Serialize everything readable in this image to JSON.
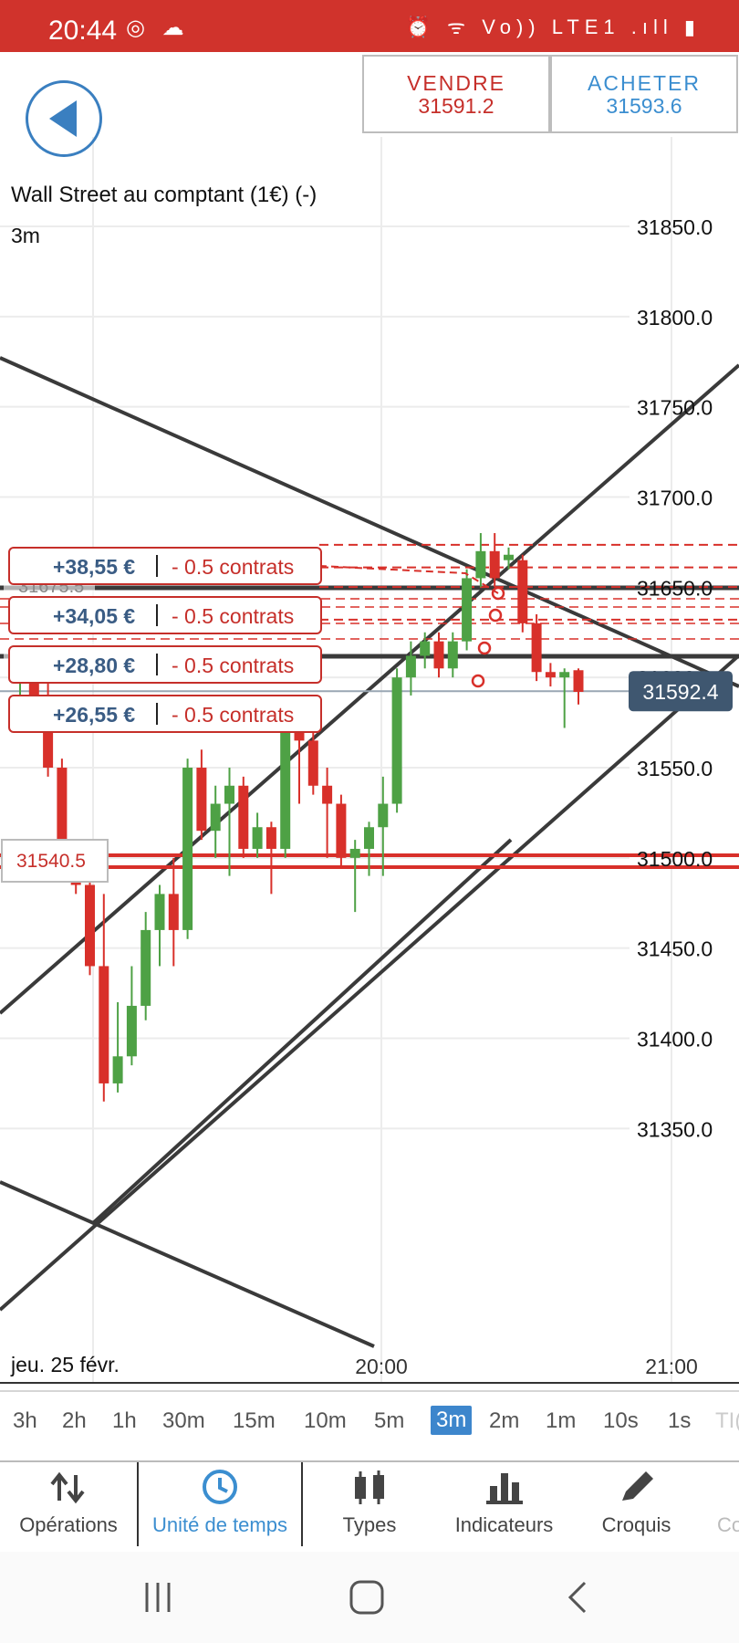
{
  "status_bar": {
    "time": "20:44",
    "icons_left": "◎ ☁",
    "icons_right": "⏰ ᯤ Vo)) LTE1 .ıll ▮"
  },
  "quote": {
    "sell_label": "VENDRE",
    "sell_price": "31591.2",
    "buy_label": "ACHETER",
    "buy_price": "31593.6"
  },
  "instrument": {
    "title": "Wall Street au comptant (1€) (-)",
    "timeframe": "3m"
  },
  "chart_data": {
    "type": "candlestick",
    "y_ticks": [
      "31850.0",
      "31800.0",
      "31750.0",
      "31700.0",
      "31650.0",
      "31600.0",
      "31550.0",
      "31500.0",
      "31450.0",
      "31400.0",
      "31350.0"
    ],
    "x_ticks": [
      "20:00",
      "21:00"
    ],
    "date_label": "jeu. 25 févr.",
    "ylim": [
      31310,
      31880
    ],
    "current_price": "31592.4",
    "positions": [
      {
        "profit": "+38,55 €",
        "size": "- 0.5 contrats",
        "entry": 31673.5
      },
      {
        "profit": "+34,05 €",
        "size": "- 0.5 contrats",
        "entry": 31661
      },
      {
        "profit": "+28,80 €",
        "size": "- 0.5 contrats",
        "entry": 31650.1
      },
      {
        "profit": "+26,55 €",
        "size": "- 0.5 contrats",
        "entry": 31632
      }
    ],
    "level_labels": [
      "31675.5",
      "31647.5"
    ],
    "order_label": "31540.5",
    "candles": [
      {
        "o": 31598,
        "h": 31610,
        "l": 31570,
        "c": 31598
      },
      {
        "o": 31598,
        "h": 31608,
        "l": 31570,
        "c": 31590
      },
      {
        "o": 31590,
        "h": 31605,
        "l": 31545,
        "c": 31550
      },
      {
        "o": 31550,
        "h": 31555,
        "l": 31500,
        "c": 31505
      },
      {
        "o": 31500,
        "h": 31510,
        "l": 31480,
        "c": 31485
      },
      {
        "o": 31485,
        "h": 31490,
        "l": 31435,
        "c": 31440
      },
      {
        "o": 31440,
        "h": 31480,
        "l": 31365,
        "c": 31375
      },
      {
        "o": 31375,
        "h": 31420,
        "l": 31370,
        "c": 31390
      },
      {
        "o": 31390,
        "h": 31440,
        "l": 31385,
        "c": 31418
      },
      {
        "o": 31418,
        "h": 31470,
        "l": 31410,
        "c": 31460
      },
      {
        "o": 31460,
        "h": 31485,
        "l": 31440,
        "c": 31480
      },
      {
        "o": 31480,
        "h": 31500,
        "l": 31440,
        "c": 31460
      },
      {
        "o": 31460,
        "h": 31555,
        "l": 31455,
        "c": 31550
      },
      {
        "o": 31550,
        "h": 31560,
        "l": 31510,
        "c": 31515
      },
      {
        "o": 31515,
        "h": 31540,
        "l": 31500,
        "c": 31530
      },
      {
        "o": 31530,
        "h": 31550,
        "l": 31490,
        "c": 31540
      },
      {
        "o": 31540,
        "h": 31545,
        "l": 31500,
        "c": 31505
      },
      {
        "o": 31505,
        "h": 31525,
        "l": 31500,
        "c": 31517
      },
      {
        "o": 31517,
        "h": 31520,
        "l": 31480,
        "c": 31505
      },
      {
        "o": 31505,
        "h": 31590,
        "l": 31500,
        "c": 31570
      },
      {
        "o": 31570,
        "h": 31580,
        "l": 31530,
        "c": 31565
      },
      {
        "o": 31565,
        "h": 31570,
        "l": 31535,
        "c": 31540
      },
      {
        "o": 31540,
        "h": 31550,
        "l": 31500,
        "c": 31530
      },
      {
        "o": 31530,
        "h": 31535,
        "l": 31495,
        "c": 31500
      },
      {
        "o": 31500,
        "h": 31510,
        "l": 31470,
        "c": 31505
      },
      {
        "o": 31505,
        "h": 31520,
        "l": 31490,
        "c": 31517
      },
      {
        "o": 31517,
        "h": 31545,
        "l": 31490,
        "c": 31530
      },
      {
        "o": 31530,
        "h": 31605,
        "l": 31525,
        "c": 31600
      },
      {
        "o": 31600,
        "h": 31620,
        "l": 31590,
        "c": 31612
      },
      {
        "o": 31612,
        "h": 31625,
        "l": 31605,
        "c": 31620
      },
      {
        "o": 31620,
        "h": 31625,
        "l": 31600,
        "c": 31605
      },
      {
        "o": 31605,
        "h": 31625,
        "l": 31600,
        "c": 31620
      },
      {
        "o": 31620,
        "h": 31660,
        "l": 31615,
        "c": 31655
      },
      {
        "o": 31655,
        "h": 31680,
        "l": 31650,
        "c": 31670
      },
      {
        "o": 31670,
        "h": 31680,
        "l": 31650,
        "c": 31655
      },
      {
        "o": 31665,
        "h": 31672,
        "l": 31660,
        "c": 31668
      },
      {
        "o": 31665,
        "h": 31668,
        "l": 31625,
        "c": 31630
      },
      {
        "o": 31630,
        "h": 31635,
        "l": 31598,
        "c": 31603
      },
      {
        "o": 31603,
        "h": 31608,
        "l": 31595,
        "c": 31600
      },
      {
        "o": 31600,
        "h": 31605,
        "l": 31572,
        "c": 31603
      },
      {
        "o": 31604,
        "h": 31605,
        "l": 31585,
        "c": 31592
      }
    ]
  },
  "timeframes": [
    "3h",
    "2h",
    "1h",
    "30m",
    "15m",
    "10m",
    "5m",
    "3m",
    "2m",
    "1m",
    "10s",
    "1s",
    "TI("
  ],
  "selected_timeframe": "3m",
  "nav": [
    {
      "label": "Opérations",
      "icon": "arrows-icon"
    },
    {
      "label": "Unité de temps",
      "icon": "clock-icon"
    },
    {
      "label": "Types",
      "icon": "candles-icon"
    },
    {
      "label": "Indicateurs",
      "icon": "bars-icon"
    },
    {
      "label": "Croquis",
      "icon": "pencil-icon"
    },
    {
      "label": "Co",
      "icon": ""
    }
  ],
  "colors": {
    "brand_red": "#d0332c",
    "accent_blue": "#3b8ed0",
    "bull": "#4ea145",
    "bear": "#d8302a",
    "price_tag": "#3f5770"
  }
}
